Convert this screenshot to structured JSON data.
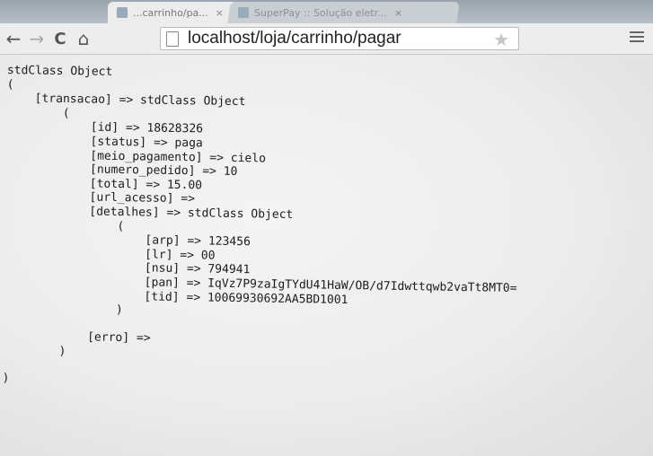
{
  "browser": {
    "tabs": [
      {
        "title": "...carrinho/pa...",
        "close": "×"
      },
      {
        "title": "SuperPay :: Solução eletr...",
        "close": "×"
      }
    ],
    "nav": {
      "back": "←",
      "forward": "→",
      "reload": "C",
      "home": "⌂"
    },
    "url": "localhost/loja/carrinho/pagar",
    "star": "★"
  },
  "dump": {
    "lines": [
      "stdClass Object",
      "(",
      "    [transacao] => stdClass Object",
      "        (",
      "            [id] => 18628326",
      "            [status] => paga",
      "            [meio_pagamento] => cielo",
      "            [numero_pedido] => 10",
      "            [total] => 15.00",
      "            [url_acesso] =>",
      "            [detalhes] => stdClass Object",
      "                (",
      "                    [arp] => 123456",
      "                    [lr] => 00",
      "                    [nsu] => 794941",
      "                    [pan] => IqVz7P9zaIgTYdU41HaW/OB/d7Idwttqwb2vaTt8MT0=",
      "                    [tid] => 10069930692AA5BD1001",
      "                )",
      "",
      "            [erro] =>",
      "        )",
      "",
      ")"
    ]
  }
}
